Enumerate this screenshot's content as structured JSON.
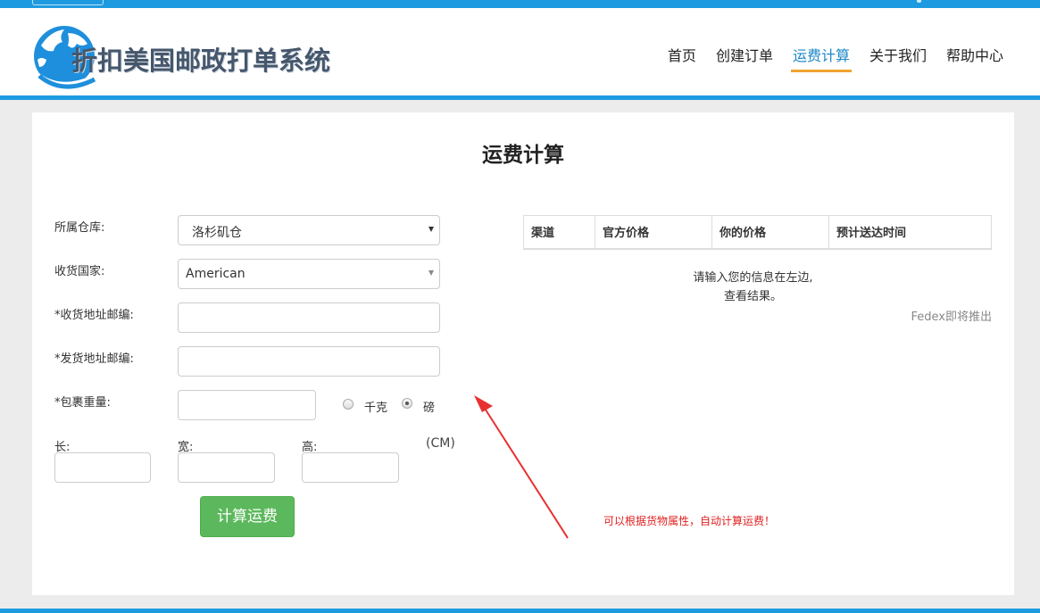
{
  "nav": {
    "items": [
      {
        "label": "首页"
      },
      {
        "label": "创建订单"
      },
      {
        "label": "运费计算"
      },
      {
        "label": "关于我们"
      },
      {
        "label": "帮助中心"
      }
    ],
    "active_index": 2
  },
  "logo": {
    "text": "折扣美国邮政打单系统"
  },
  "page": {
    "title": "运费计算"
  },
  "form": {
    "warehouse": {
      "label": "所属仓库:",
      "value": "洛杉矶仓"
    },
    "country": {
      "label": "收货国家:",
      "value": "American"
    },
    "dest_zip": {
      "label": "*收货地址邮编:",
      "value": "",
      "placeholder": ""
    },
    "origin_zip": {
      "label": "*发货地址邮编:",
      "value": "",
      "placeholder": ""
    },
    "weight": {
      "label": "*包裹重量:",
      "value": "",
      "placeholder": ""
    },
    "unit_kg": "千克",
    "unit_lb": "磅",
    "unit_selected": "磅",
    "length": {
      "label": "长:",
      "value": ""
    },
    "width": {
      "label": "宽:",
      "value": ""
    },
    "height": {
      "label": "高:",
      "value": ""
    },
    "dim_unit": "(CM)",
    "submit_label": "计算运费"
  },
  "results": {
    "columns": [
      "渠道",
      "官方价格",
      "你的价格",
      "预计送达时间"
    ],
    "hint_line1": "请输入您的信息在左边,",
    "hint_line2": "查看结果。",
    "fedex_note": "Fedex即将推出"
  },
  "annotation": {
    "text": "可以根据货物属性，自动计算运费！",
    "color": "#e02020"
  },
  "colors": {
    "brand_blue": "#1e9be0",
    "active_underline": "#f0a330",
    "button_green": "#5cb85c"
  }
}
